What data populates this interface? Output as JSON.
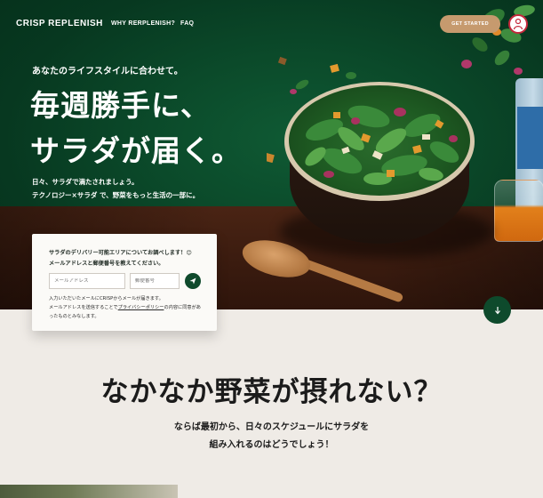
{
  "header": {
    "logo": "CRISP REPLENISH",
    "nav": [
      "WHY RERPLENISH?",
      "FAQ"
    ],
    "cta": "GET STARTED",
    "badge_icon": "person-badge-icon"
  },
  "hero": {
    "tagline": "あなたのライフスタイルに合わせて。",
    "headline_line1": "毎週勝手に、",
    "headline_line2": "サラダが届く。",
    "sub_line1": "日々、サラダで満たされましょう。",
    "sub_line2": "テクノロジー×サラダ で、野菜をもっと生活の一部に。"
  },
  "form": {
    "title_line1": "サラダのデリバリー可能エリアについてお調べします！😊",
    "title_line2": "メールアドレスと郵便番号を教えてください。",
    "email_placeholder": "メールアドレス",
    "zip_placeholder": "郵便番号",
    "send_icon": "paper-plane-icon",
    "note_line1": "入力いただいたメールにCRISPからメールが届きます。",
    "note_line2_pre": "メールアドレスを送信することで",
    "note_link": "プライバシーポリシー",
    "note_line2_post": "の内容に同意があ",
    "note_line3": "ったものとみなします。"
  },
  "scroll_icon": "arrow-down-icon",
  "section": {
    "title": "なかなか野菜が摂れない？",
    "body_line1": "ならば最初から、日々のスケジュールにサラダを",
    "body_line2": "組み入れるのはどうでしょう！"
  },
  "colors": {
    "hero_green": "#0b4a2a",
    "cta": "#c69a6e",
    "button_green": "#0f4a2c",
    "page_bg": "#efebe6"
  }
}
